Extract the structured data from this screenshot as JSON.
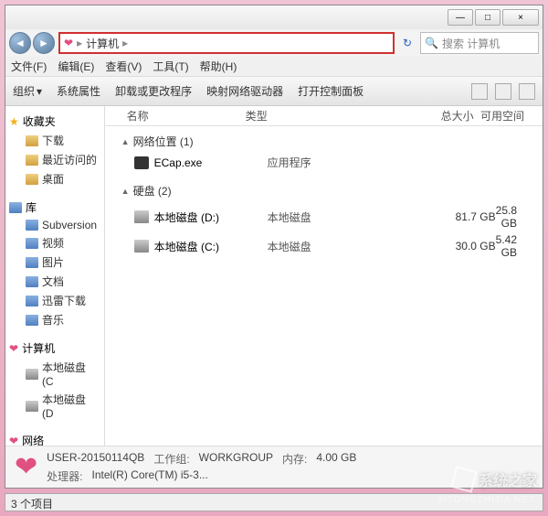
{
  "window": {
    "min": "—",
    "max": "□",
    "close": "×"
  },
  "nav": {
    "back": "◄",
    "fwd": "►"
  },
  "breadcrumb": {
    "root": "计算机",
    "sep": "▸"
  },
  "search": {
    "icon": "🔍",
    "placeholder": "搜索 计算机"
  },
  "menu": {
    "file": "文件(F)",
    "edit": "编辑(E)",
    "view": "查看(V)",
    "tools": "工具(T)",
    "help": "帮助(H)"
  },
  "toolbar": {
    "organize": "组织",
    "sysprops": "系统属性",
    "uninstall": "卸载或更改程序",
    "mapdrive": "映射网络驱动器",
    "controlpanel": "打开控制面板"
  },
  "sidebar": {
    "fav": "收藏夹",
    "fav_items": [
      "下载",
      "最近访问的",
      "桌面"
    ],
    "lib": "库",
    "lib_items": [
      "Subversion",
      "视频",
      "图片",
      "文档",
      "迅雷下载",
      "音乐"
    ],
    "computer": "计算机",
    "drives": [
      "本地磁盘 (C",
      "本地磁盘 (D"
    ],
    "network": "网络"
  },
  "columns": {
    "name": "名称",
    "type": "类型",
    "total": "总大小",
    "free": "可用空间"
  },
  "sections": {
    "netloc": "网络位置 (1)",
    "disks": "硬盘 (2)"
  },
  "items": {
    "ecap": {
      "name": "ECap.exe",
      "type": "应用程序"
    },
    "d": {
      "name": "本地磁盘 (D:)",
      "type": "本地磁盘",
      "total": "81.7 GB",
      "free": "25.8 GB"
    },
    "c": {
      "name": "本地磁盘 (C:)",
      "type": "本地磁盘",
      "total": "30.0 GB",
      "free": "5.42 GB"
    }
  },
  "details": {
    "name": "USER-20150114QB",
    "workgroup_label": "工作组:",
    "workgroup": "WORKGROUP",
    "mem_label": "内存:",
    "mem": "4.00 GB",
    "cpu_label": "处理器:",
    "cpu": "Intel(R) Core(TM) i5-3..."
  },
  "status": "3 个项目",
  "watermark": {
    "text": "系统之家",
    "url": "XITONGZHIJIA.NET"
  }
}
